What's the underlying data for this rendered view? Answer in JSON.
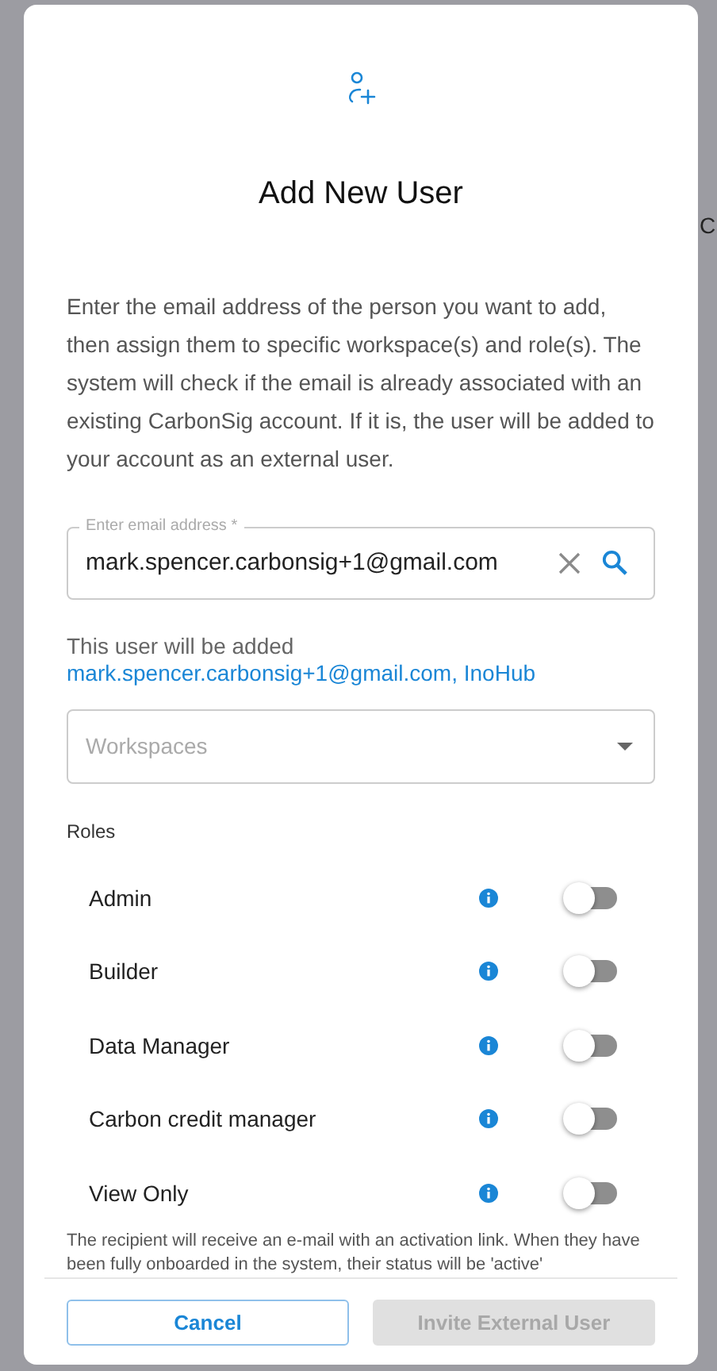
{
  "background": {
    "text": "C"
  },
  "dialog": {
    "title": "Add New User",
    "intro": "Enter the email address of the person you want to add, then assign them to specific workspace(s) and role(s). The system will check if the email is already associated with an existing CarbonSig account. If it is, the user will be added to your account as an external user.",
    "email_field": {
      "label": "Enter email address *",
      "value": "mark.spencer.carbonsig+1@gmail.com"
    },
    "result_note": "This user will be added",
    "result_value": "mark.spencer.carbonsig+1@gmail.com, InoHub",
    "workspaces": {
      "placeholder": "Workspaces"
    },
    "roles_label": "Roles",
    "roles": [
      {
        "name": "Admin",
        "on": false
      },
      {
        "name": "Builder",
        "on": false
      },
      {
        "name": "Data Manager",
        "on": false
      },
      {
        "name": "Carbon credit manager",
        "on": false
      },
      {
        "name": "View Only",
        "on": false
      }
    ],
    "footnote": "The recipient will receive an e-mail with an activation link. When they have been fully onboarded in the system, their status will be 'active'",
    "buttons": [
      {
        "label": "Cancel",
        "disabled": false
      },
      {
        "label": "Invite External User",
        "disabled": true
      }
    ]
  }
}
